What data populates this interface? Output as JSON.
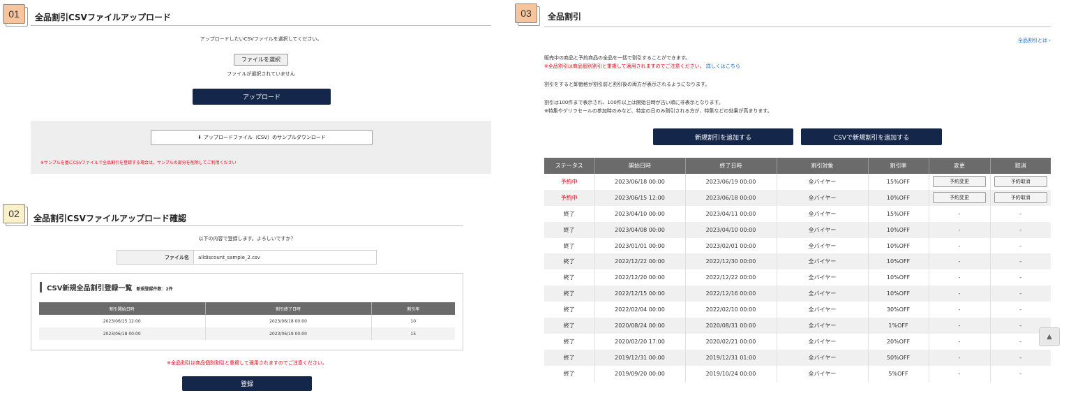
{
  "s01": {
    "badge": "01",
    "title": "全品割引CSVファイルアップロード",
    "instruction": "アップロードしたいCSVファイルを選択してください。",
    "choose_file_label": "ファイルを選択",
    "no_file_text": "ファイルが選択されていません",
    "upload_label": "アップロード",
    "sample_download_label": "アップロードファイル（CSV）のサンプルダウンロード",
    "sample_note": "※サンプルを基にCSVファイルで全品割引を登録する場合は、サンプルの部分を削除してご利用ください"
  },
  "s02": {
    "badge": "02",
    "title": "全品割引CSVファイルアップロード確認",
    "confirm_text": "以下の内容で登録します。よろしいですか？",
    "file_label": "ファイル名",
    "file_value": "alldiscount_sample_2.csv",
    "list_title": "CSV新規全品割引登録一覧",
    "list_count": "新規登録件数：2件",
    "columns": [
      "割引開始日時",
      "割引終了日時",
      "割引率"
    ],
    "rows": [
      [
        "2023/06/15 12:00",
        "2023/06/18 00:00",
        "10"
      ],
      [
        "2023/06/18 00:00",
        "2023/06/19 00:00",
        "15"
      ]
    ],
    "warning": "※全品割引は商品個別割引と重複して適用されますのでご注意ください。",
    "register_label": "登録"
  },
  "s03": {
    "badge": "03",
    "title": "全品割引",
    "help_link": "全品割引とは",
    "desc1": "販売中の商品と予約商品の全品を一括で割引することができます。",
    "warn_text": "※全品割引は商品個別割引と重複して適用されますのでご注意ください。",
    "detail_link": "詳しくはこちら",
    "desc2": "割引をすると卸価格が割引前と割引後の両方が表示されるようになります。",
    "desc3": "割引は100件まで表示され、100件以上は開始日時が古い順に非表示となります。",
    "desc4": "※特集やゲリラセールの参加時のみなど、特定の日のみ割引される方が、特集などの効果が高まります。",
    "add_button": "新規割引を追加する",
    "csv_add_button": "CSVで新規割引を追加する",
    "columns": [
      "ステータス",
      "開始日時",
      "終了日時",
      "割引対象",
      "割引率",
      "変更",
      "取消"
    ],
    "change_btn": "予約変更",
    "cancel_btn": "予約取消",
    "rows": [
      {
        "status": "予約中",
        "start": "2023/06/18 00:00",
        "end": "2023/06/19 00:00",
        "target": "全バイヤー",
        "rate": "15%OFF",
        "change": "",
        "cancel": ""
      },
      {
        "status": "予約中",
        "start": "2023/06/15 12:00",
        "end": "2023/06/18 00:00",
        "target": "全バイヤー",
        "rate": "10%OFF",
        "change": "",
        "cancel": ""
      },
      {
        "status": "終了",
        "start": "2023/04/10 00:00",
        "end": "2023/04/11 00:00",
        "target": "全バイヤー",
        "rate": "15%OFF",
        "change": "-",
        "cancel": "-"
      },
      {
        "status": "終了",
        "start": "2023/04/08 00:00",
        "end": "2023/04/10 00:00",
        "target": "全バイヤー",
        "rate": "10%OFF",
        "change": "-",
        "cancel": "-"
      },
      {
        "status": "終了",
        "start": "2023/01/01 00:00",
        "end": "2023/02/01 00:00",
        "target": "全バイヤー",
        "rate": "10%OFF",
        "change": "-",
        "cancel": "-"
      },
      {
        "status": "終了",
        "start": "2022/12/22 00:00",
        "end": "2022/12/30 00:00",
        "target": "全バイヤー",
        "rate": "10%OFF",
        "change": "-",
        "cancel": "-"
      },
      {
        "status": "終了",
        "start": "2022/12/20 00:00",
        "end": "2022/12/22 00:00",
        "target": "全バイヤー",
        "rate": "10%OFF",
        "change": "-",
        "cancel": "-"
      },
      {
        "status": "終了",
        "start": "2022/12/15 00:00",
        "end": "2022/12/16 00:00",
        "target": "全バイヤー",
        "rate": "10%OFF",
        "change": "-",
        "cancel": "-"
      },
      {
        "status": "終了",
        "start": "2022/02/04 00:00",
        "end": "2022/02/10 00:00",
        "target": "全バイヤー",
        "rate": "30%OFF",
        "change": "-",
        "cancel": "-"
      },
      {
        "status": "終了",
        "start": "2020/08/24 00:00",
        "end": "2020/08/31 00:00",
        "target": "全バイヤー",
        "rate": "1%OFF",
        "change": "-",
        "cancel": "-"
      },
      {
        "status": "終了",
        "start": "2020/02/20 17:00",
        "end": "2020/02/21 00:00",
        "target": "全バイヤー",
        "rate": "20%OFF",
        "change": "-",
        "cancel": "-"
      },
      {
        "status": "終了",
        "start": "2019/12/31 00:00",
        "end": "2019/12/31 01:00",
        "target": "全バイヤー",
        "rate": "50%OFF",
        "change": "-",
        "cancel": "-"
      },
      {
        "status": "終了",
        "start": "2019/09/20 00:00",
        "end": "2019/10/24 00:00",
        "target": "全バイヤー",
        "rate": "5%OFF",
        "change": "-",
        "cancel": "-"
      }
    ]
  },
  "colors": {
    "navy": "#14264a",
    "red": "#e60012",
    "link": "#1565c0",
    "badge_orange": "#f7c59d",
    "badge_cream": "#fbf0c9"
  },
  "icons": {
    "download": "download-icon",
    "pagetop": "chevron-up-icon"
  }
}
